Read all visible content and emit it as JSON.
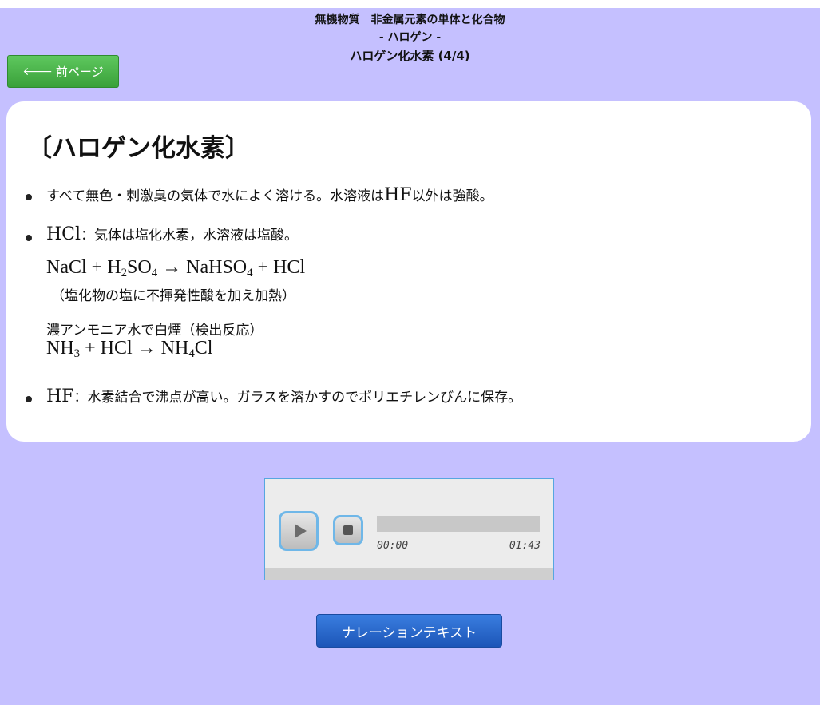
{
  "header": {
    "line1": "無機物質　非金属元素の単体と化合物",
    "line2": "- ハロゲン -",
    "line3": "ハロゲン化水素 (4/4)"
  },
  "nav": {
    "prev_arrow": "🡐",
    "prev_label": "前ページ"
  },
  "card": {
    "title": "〔ハロゲン化水素〕",
    "item1": {
      "pre": "すべて無色・刺激臭の気体で水によく溶ける。水溶液は",
      "hf": "HF",
      "post": "以外は強酸。"
    },
    "item2": {
      "hcl": "HCl",
      "text": "：気体は塩化水素，水溶液は塩酸。",
      "eq1": {
        "a": "NaCl",
        "plus1": "+",
        "b": "H",
        "b_sub": "2",
        "c": "SO",
        "c_sub": "4",
        "arrow": "→",
        "d": "NaHSO",
        "d_sub": "4",
        "plus2": "+",
        "e": "HCl"
      },
      "eq1_note": "（塩化物の塩に不揮発性酸を加え加熱）",
      "detect": "濃アンモニア水で白煙（検出反応）",
      "eq2": {
        "a": "NH",
        "a_sub": "3",
        "plus": "+",
        "b": "HCl",
        "arrow": "→",
        "c": "NH",
        "c_sub": "4",
        "d": "Cl"
      }
    },
    "item3": {
      "hf": "HF",
      "text": "：水素結合で沸点が高い。ガラスを溶かすのでポリエチレンびんに保存。"
    }
  },
  "player": {
    "current_time": "00:00",
    "total_time": "01:43",
    "progress": 0,
    "play_icon": "play-icon",
    "stop_icon": "stop-icon"
  },
  "narration_button": "ナレーションテキスト"
}
